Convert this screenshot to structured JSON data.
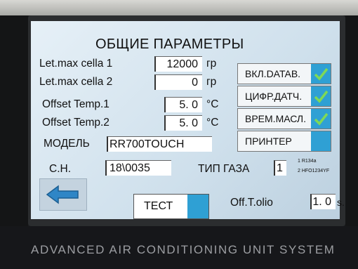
{
  "screen": {
    "title": "ОБЩИЕ ПАРАМЕТРЫ",
    "params": [
      {
        "label": "Let.max cella 1",
        "value": "12000",
        "unit": "гр"
      },
      {
        "label": "Let.max cella 2",
        "value": "0",
        "unit": "гр"
      },
      {
        "label": "Offset Temp.1",
        "value": "5. 0",
        "unit": "°C"
      },
      {
        "label": "Offset Temp.2",
        "value": "5. 0",
        "unit": "°C"
      }
    ],
    "model_label": "МОДЕЛЬ",
    "model_value": "RR700TOUCH",
    "serial_label": "С.Н.",
    "serial_value": "18\\0035",
    "gas_label": "ТИП ГАЗА",
    "gas_value": "1",
    "gas_options": [
      "1 R134a",
      "2 HFO1234YF"
    ],
    "side_buttons": [
      {
        "label": "ВКЛ.DATAB.",
        "checked": true
      },
      {
        "label": "ЦИФР.ДАТЧ.",
        "checked": true
      },
      {
        "label": "ВРЕМ.МАСЛ.",
        "checked": true
      },
      {
        "label": "ПРИНТЕР",
        "checked": false
      }
    ],
    "test_label": "ТЕСТ",
    "oil_label": "Off.T.olio",
    "oil_value": "1. 0",
    "oil_unit": "s.",
    "accent": "#2fa0d4",
    "check_color": "#7ed957"
  },
  "footer": {
    "text": "ADVANCED AIR CONDITIONING UNIT SYSTEM"
  }
}
